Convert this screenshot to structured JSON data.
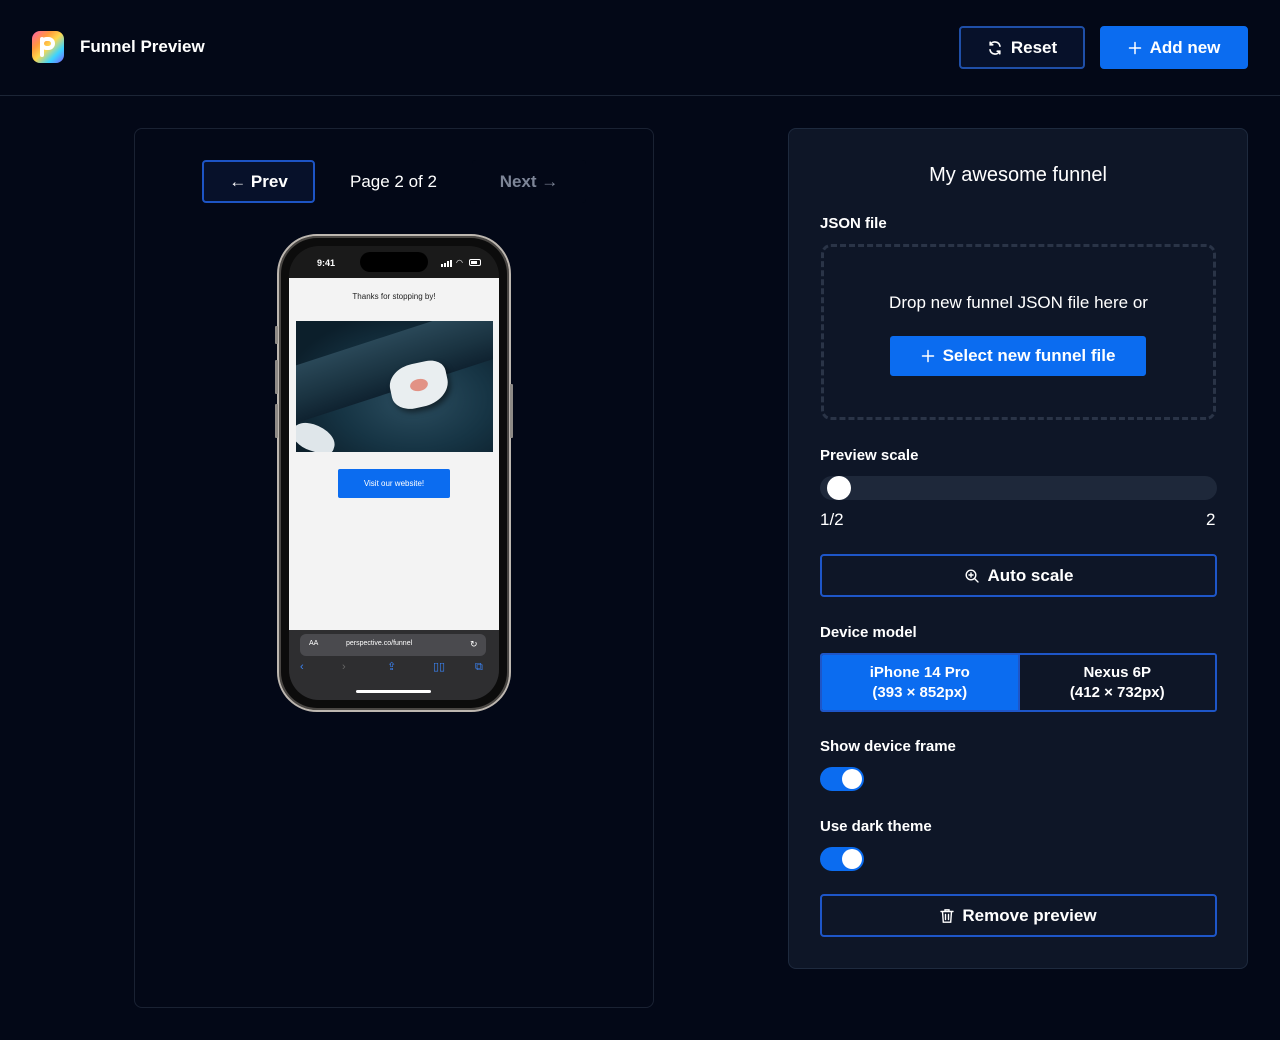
{
  "header": {
    "title": "Funnel Preview",
    "reset_label": "Reset",
    "add_label": "Add new"
  },
  "preview": {
    "prev_label": "← Prev",
    "page_indicator": "Page 2 of 2",
    "next_label": "Next →",
    "phone": {
      "time": "9:41",
      "message": "Thanks for stopping by!",
      "cta_label": "Visit our website!",
      "text_size_label": "AA",
      "url": "perspective.co/funnel"
    }
  },
  "settings": {
    "funnel_name": "My awesome funnel",
    "json_label": "JSON file",
    "drop_text": "Drop new funnel JSON file here or",
    "select_label": "Select new funnel file",
    "scale_label": "Preview scale",
    "scale_min": "1/2",
    "scale_max": "2",
    "scale_value": 0.5,
    "auto_scale_label": "Auto scale",
    "device_label": "Device model",
    "devices": [
      {
        "name": "iPhone 14 Pro",
        "size": "(393 × 852px)",
        "selected": true
      },
      {
        "name": "Nexus 6P",
        "size": "(412 × 732px)",
        "selected": false
      }
    ],
    "frame_label": "Show device frame",
    "frame_on": true,
    "dark_label": "Use dark theme",
    "dark_on": true,
    "remove_label": "Remove preview"
  },
  "colors": {
    "background": "#030817",
    "panel": "#0e1627",
    "accent": "#0b6cf0",
    "border_accent": "#1e56c8"
  },
  "icons": {
    "logo": "perspective-logo-icon",
    "reset": "refresh-icon",
    "add": "plus-icon",
    "auto_scale": "zoom-in-icon",
    "remove": "trash-icon"
  }
}
